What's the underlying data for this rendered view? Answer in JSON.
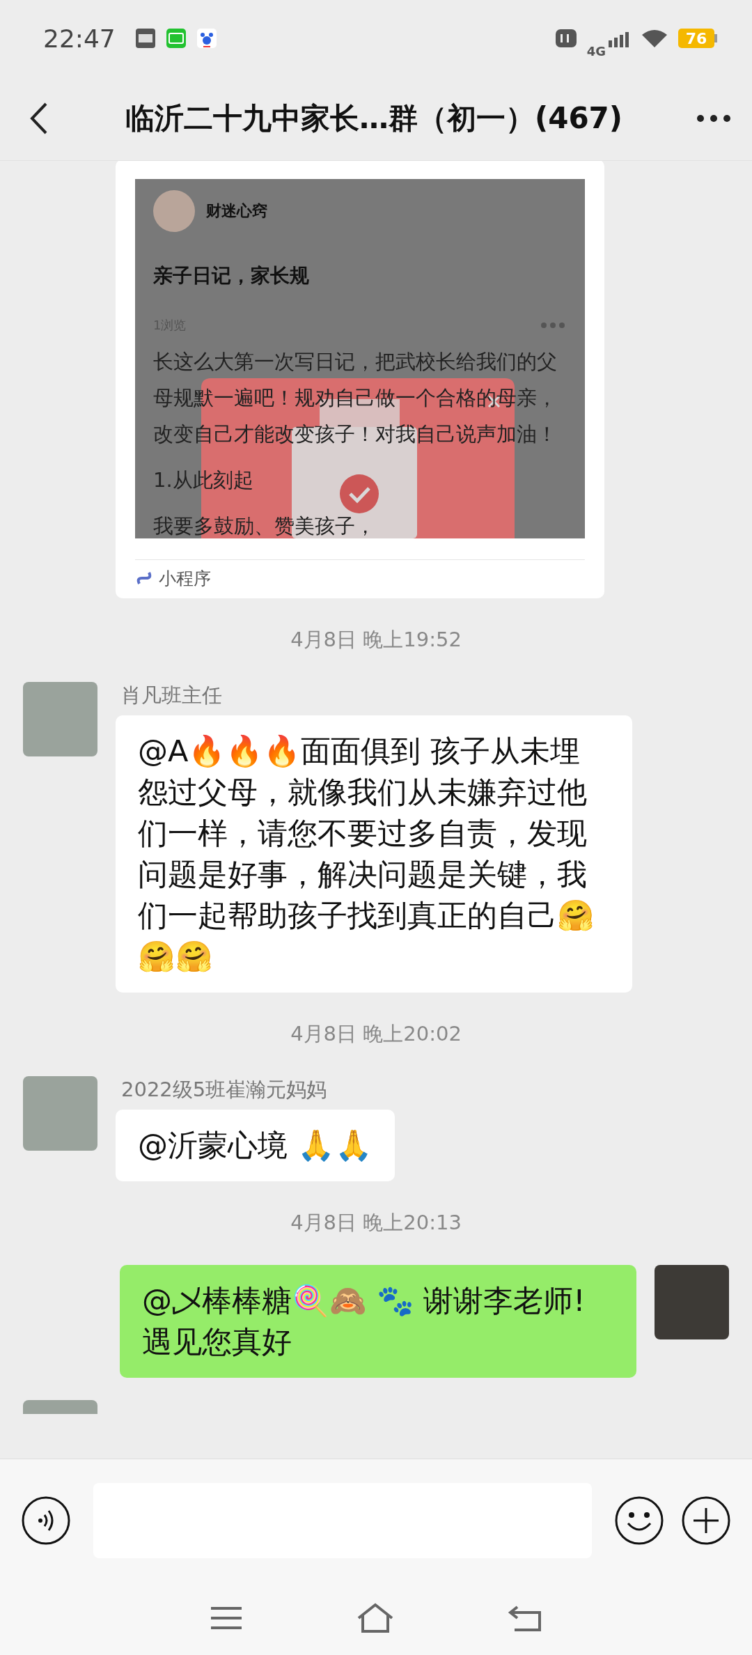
{
  "status_bar": {
    "time": "22:47",
    "battery": "76",
    "network": "4G"
  },
  "header": {
    "title": "临沂二十九中家长…群（初一）(467)"
  },
  "messages": [
    {
      "kind": "card",
      "author": "财迷心窍",
      "title": "亲子日记，家长规",
      "views": "1浏览",
      "body": [
        "长这么大第一次写日记，把武校长给我们的父母规默一遍吧！规劝自己做一个合格的母亲，改变自己才能改变孩子！对我自己说声加油！",
        "1.从此刻起",
        "我要多鼓励、赞美孩子，"
      ],
      "footer": "小程序",
      "outgoing": false
    },
    {
      "kind": "time",
      "text": "4月8日 晚上19:52"
    },
    {
      "kind": "text",
      "outgoing": false,
      "sender": "肖凡班主任",
      "text": "@A🔥🔥🔥面面俱到  孩子从未埋怨过父母，就像我们从未嫌弃过他们一样，请您不要过多自责，发现问题是好事，解决问题是关键，我们一起帮助孩子找到真正的自己🤗🤗🤗"
    },
    {
      "kind": "time",
      "text": "4月8日 晚上20:02"
    },
    {
      "kind": "text",
      "outgoing": false,
      "sender": "2022级5班崔瀚元妈妈",
      "text": "@沂蒙心境  🙏🙏"
    },
    {
      "kind": "time",
      "text": "4月8日 晚上20:13"
    },
    {
      "kind": "text",
      "outgoing": true,
      "text": "@乄棒棒糖🍭🙈 🐾 谢谢李老师!遇见您真好"
    },
    {
      "kind": "partial"
    }
  ]
}
